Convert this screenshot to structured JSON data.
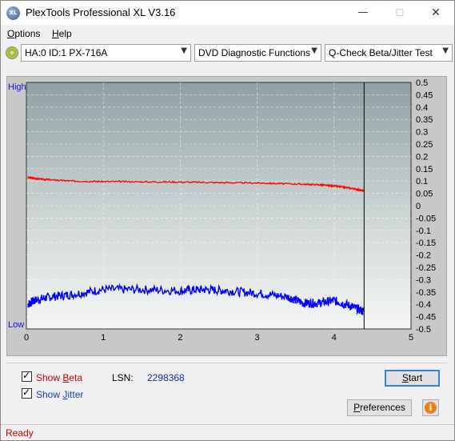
{
  "window": {
    "title": "PlexTools Professional XL V3.16",
    "icon_text": "XL",
    "controls": {
      "min": "—",
      "max": "☐",
      "close": "✕"
    }
  },
  "menu": [
    {
      "label": "Options",
      "accel": "O",
      "rest": "ptions"
    },
    {
      "label": "Help",
      "accel": "H",
      "rest": "elp"
    }
  ],
  "toolbar": {
    "drive": "HA:0 ID:1  PX-716A",
    "function": "DVD Diagnostic Functions",
    "test": "Q-Check Beta/Jitter Test",
    "arrow": "▼"
  },
  "chart_data": {
    "type": "line",
    "left_axis_labels": {
      "high": "High",
      "low": "Low"
    },
    "x_ticks": [
      "0",
      "1",
      "2",
      "3",
      "4",
      "5"
    ],
    "xlim": [
      0,
      5
    ],
    "y_ticks": [
      "0.5",
      "0.45",
      "0.4",
      "0.35",
      "0.3",
      "0.25",
      "0.2",
      "0.15",
      "0.1",
      "0.05",
      "0",
      "-0.05",
      "-0.1",
      "-0.15",
      "-0.2",
      "-0.25",
      "-0.3",
      "-0.35",
      "-0.4",
      "-0.45",
      "-0.5"
    ],
    "ylim": [
      -0.5,
      0.5
    ],
    "grid": true,
    "end_marker_x": 4.39,
    "series": [
      {
        "name": "Beta",
        "color": "#ff0000",
        "x": [
          0.02,
          0.1,
          0.3,
          0.6,
          1.0,
          1.5,
          2.0,
          2.5,
          3.0,
          3.5,
          3.8,
          4.0,
          4.2,
          4.39
        ],
        "y": [
          0.115,
          0.11,
          0.105,
          0.1,
          0.098,
          0.097,
          0.096,
          0.094,
          0.092,
          0.088,
          0.085,
          0.08,
          0.072,
          0.06
        ]
      },
      {
        "name": "Jitter",
        "color": "#0000ff",
        "x": [
          0.02,
          0.1,
          0.3,
          0.6,
          1.0,
          1.5,
          2.0,
          2.3,
          2.6,
          3.0,
          3.4,
          3.6,
          3.8,
          4.0,
          4.2,
          4.39
        ],
        "y": [
          -0.4,
          -0.385,
          -0.37,
          -0.36,
          -0.34,
          -0.34,
          -0.345,
          -0.34,
          -0.345,
          -0.355,
          -0.37,
          -0.395,
          -0.395,
          -0.385,
          -0.405,
          -0.43
        ]
      }
    ]
  },
  "bottom": {
    "show_beta": {
      "pre": "Show ",
      "accel": "B",
      "rest": "eta"
    },
    "show_jitter": {
      "pre": "Show ",
      "accel": "J",
      "rest": "itter"
    },
    "lsn_label": "LSN:",
    "lsn_value": "2298368",
    "start_label": "Start",
    "start_accel": "S",
    "start_rest": "tart",
    "preferences_pre": "P",
    "preferences_rest": "references",
    "info_glyph": "i"
  },
  "status": "Ready",
  "colors": {
    "beta_label": "#cc0000",
    "jitter_label": "#1a3fbf",
    "high_low": "#1010cc",
    "lsn_value": "#1a2f8f"
  }
}
